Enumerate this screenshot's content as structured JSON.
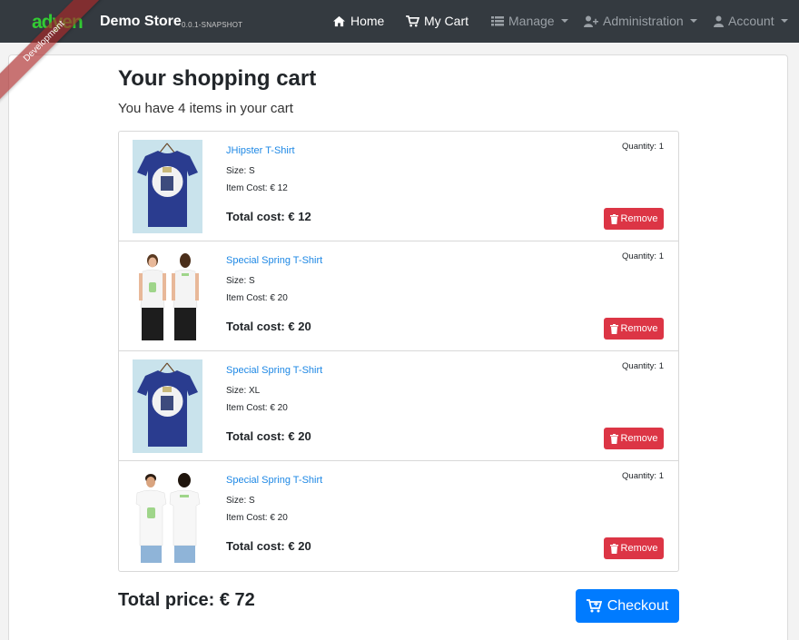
{
  "colors": {
    "navbar": "#343a40",
    "link": "#1e88e5",
    "danger": "#dc3545",
    "primary": "#007bff",
    "logo_green": "#33cc33",
    "ribbon": "#aa2828"
  },
  "navbar": {
    "brand_title": "Demo Store",
    "brand_version": "0.0.1-SNAPSHOT",
    "ribbon_text": "Development",
    "items": [
      {
        "label": "Home",
        "icon": "home-icon"
      },
      {
        "label": "My Cart",
        "icon": "cart-icon"
      },
      {
        "label": "Manage",
        "icon": "list-icon"
      },
      {
        "label": "Administration",
        "icon": "user-plus-icon"
      },
      {
        "label": "Account",
        "icon": "user-icon"
      }
    ]
  },
  "cart": {
    "title": "Your shopping cart",
    "subtitle": "You have 4 items in your cart",
    "items": [
      {
        "name": "JHipster T-Shirt",
        "size": "Size: S",
        "item_cost": "Item Cost: € 12",
        "total": "Total cost: € 12",
        "quantity": "Quantity: 1",
        "remove_label": "Remove",
        "image": "blue-tshirt"
      },
      {
        "name": "Special Spring T-Shirt",
        "size": "Size: S",
        "item_cost": "Item Cost: € 20",
        "total": "Total cost: € 20",
        "quantity": "Quantity: 1",
        "remove_label": "Remove",
        "image": "woman-white-tshirt"
      },
      {
        "name": "Special Spring T-Shirt",
        "size": "Size: XL",
        "item_cost": "Item Cost: € 20",
        "total": "Total cost: € 20",
        "quantity": "Quantity: 1",
        "remove_label": "Remove",
        "image": "blue-tshirt"
      },
      {
        "name": "Special Spring T-Shirt",
        "size": "Size: S",
        "item_cost": "Item Cost: € 20",
        "total": "Total cost: € 20",
        "quantity": "Quantity: 1",
        "remove_label": "Remove",
        "image": "man-white-tshirt"
      }
    ],
    "total_price": "Total price: € 72",
    "checkout_label": "Checkout"
  }
}
